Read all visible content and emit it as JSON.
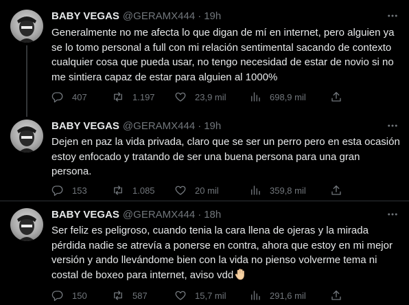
{
  "tweets": [
    {
      "name": "BABY VEGAS",
      "handle": "@GERAMX444",
      "separator": "·",
      "time": "19h",
      "text": "Generalmente no me afecta lo que digan de mí en internet, pero alguien ya\nse lo tomo personal a full con mi relación sentimental sacando de contexto\ncualquier cosa que pueda usar, no tengo necesidad de estar de novio si no\nme sintiera capaz de estar para alguien al 1000%",
      "replies": "407",
      "retweets": "1.197",
      "likes": "23,9 mil",
      "views": "698,9 mil"
    },
    {
      "name": "BABY VEGAS",
      "handle": "@GERAMX444",
      "separator": "·",
      "time": "19h",
      "text": "Dejen en paz la vida privada, claro que se ser un perro pero en esta ocasión\nestoy enfocado y tratando de ser una buena persona para una gran\npersona.",
      "replies": "153",
      "retweets": "1.085",
      "likes": "20 mil",
      "views": "359,8 mil"
    },
    {
      "name": "BABY VEGAS",
      "handle": "@GERAMX444",
      "separator": "·",
      "time": "18h",
      "text": "Ser feliz es peligroso, cuando tenia la cara llena de ojeras y la mirada\npérdida nadie se atrevía a ponerse en contra, ahora que estoy en mi mejor\nversión y ando llevándome bien con la vida no pienso volverme tema ni\ncostal de boxeo para internet, aviso vdd",
      "emoji": "raised-hand-emoji",
      "replies": "150",
      "retweets": "587",
      "likes": "15,7 mil",
      "views": "291,6 mil"
    }
  ],
  "icons": {
    "reply": "reply-icon",
    "retweet": "retweet-icon",
    "like": "like-icon",
    "views": "views-icon",
    "share": "share-icon",
    "more": "more-icon"
  },
  "colors": {
    "background": "#000000",
    "text": "#e7e9ea",
    "muted": "#71767b",
    "divider": "#2f3336"
  }
}
